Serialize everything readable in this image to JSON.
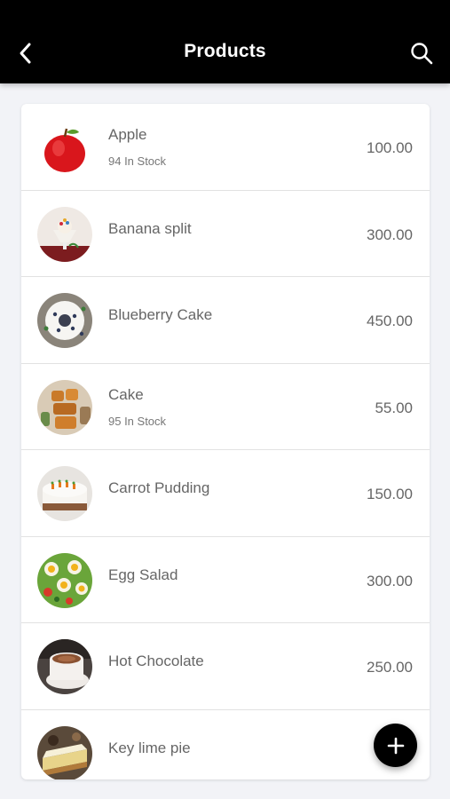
{
  "header": {
    "title": "Products",
    "back_icon": "chevron-left-icon",
    "search_icon": "search-icon",
    "background": "#000000"
  },
  "products": [
    {
      "name": "Apple",
      "stock": "94 In Stock",
      "price": "100.00",
      "image": "apple"
    },
    {
      "name": "Banana split",
      "stock": "",
      "price": "300.00",
      "image": "banana-split"
    },
    {
      "name": "Blueberry Cake",
      "stock": "",
      "price": "450.00",
      "image": "blueberry-cake"
    },
    {
      "name": "Cake",
      "stock": "95 In Stock",
      "price": "55.00",
      "image": "cake"
    },
    {
      "name": "Carrot Pudding",
      "stock": "",
      "price": "150.00",
      "image": "carrot-pudding"
    },
    {
      "name": "Egg Salad",
      "stock": "",
      "price": "300.00",
      "image": "egg-salad"
    },
    {
      "name": "Hot Chocolate",
      "stock": "",
      "price": "250.00",
      "image": "hot-chocolate"
    },
    {
      "name": "Key lime pie",
      "stock": "",
      "price": "",
      "image": "key-lime-pie"
    }
  ],
  "fab": {
    "icon": "plus-icon",
    "color": "#000000"
  }
}
